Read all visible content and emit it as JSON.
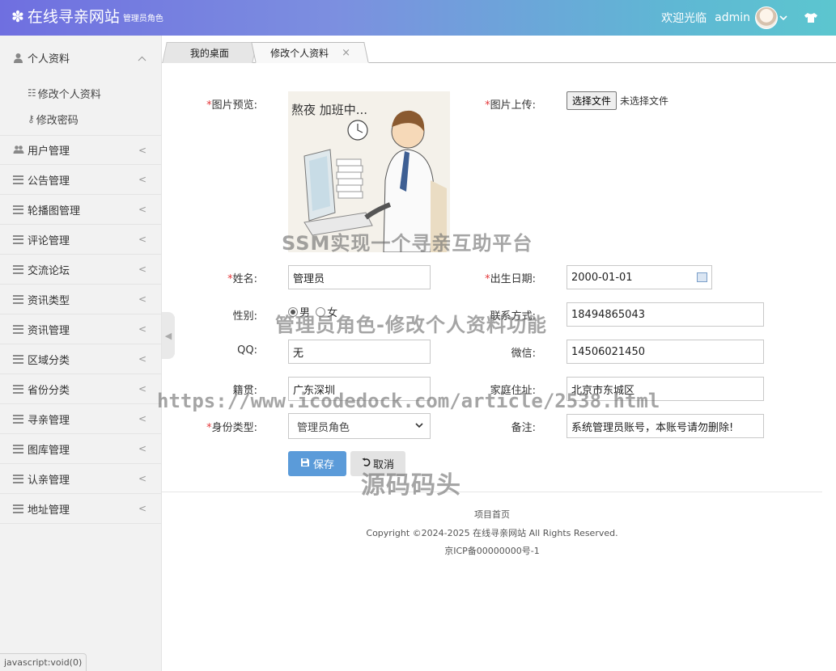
{
  "header": {
    "logo_icon": "gear-icon",
    "title": "在线寻亲网站",
    "role": "管理员角色",
    "welcome": "欢迎光临",
    "username": "admin",
    "theme_icon": "shirt-icon"
  },
  "sidebar": {
    "group_personal": {
      "label": "个人资料",
      "items": [
        {
          "label": "修改个人资料"
        },
        {
          "label": "修改密码"
        }
      ]
    },
    "items": [
      {
        "label": "用户管理"
      },
      {
        "label": "公告管理"
      },
      {
        "label": "轮播图管理"
      },
      {
        "label": "评论管理"
      },
      {
        "label": "交流论坛"
      },
      {
        "label": "资讯类型"
      },
      {
        "label": "资讯管理"
      },
      {
        "label": "区域分类"
      },
      {
        "label": "省份分类"
      },
      {
        "label": "寻亲管理"
      },
      {
        "label": "图库管理"
      },
      {
        "label": "认亲管理"
      },
      {
        "label": "地址管理"
      }
    ]
  },
  "tabs": [
    {
      "label": "我的桌面"
    },
    {
      "label": "修改个人资料"
    }
  ],
  "form": {
    "preview_label": "图片预览:",
    "upload_label": "图片上传:",
    "upload_button": "选择文件",
    "upload_status": "未选择文件",
    "preview_text": "熬夜 加班中...",
    "name_label": "姓名:",
    "name_value": "管理员",
    "birth_label": "出生日期:",
    "birth_value": "2000-01-01",
    "gender_label": "性别:",
    "gender_male": "男",
    "gender_female": "女",
    "phone_label": "联系方式:",
    "phone_value": "18494865043",
    "qq_label": "QQ:",
    "qq_value": "无",
    "wechat_label": "微信:",
    "wechat_value": "14506021450",
    "origin_label": "籍贯:",
    "origin_value": "广东深圳",
    "address_label": "家庭住址:",
    "address_value": "北京市东城区",
    "identity_label": "身份类型:",
    "identity_value": "管理员角色",
    "remark_label": "备注:",
    "remark_value": "系统管理员账号，本账号请勿删除!",
    "save_label": "保存",
    "cancel_label": "取消"
  },
  "footer": {
    "home_link": "项目首页",
    "copyright": "Copyright ©2024-2025 在线寻亲网站 All Rights Reserved.",
    "icp": "京ICP备00000000号-1"
  },
  "watermarks": {
    "w1": "SSM实现一个寻亲互助平台",
    "w2": "管理员角色-修改个人资料功能",
    "w3": "https://www.icodedock.com/article/2538.html",
    "w4": "源码码头"
  },
  "status_bar": "javascript:void(0)",
  "colors": {
    "required": "#e5383b",
    "save_button": "#5b9bd9"
  }
}
